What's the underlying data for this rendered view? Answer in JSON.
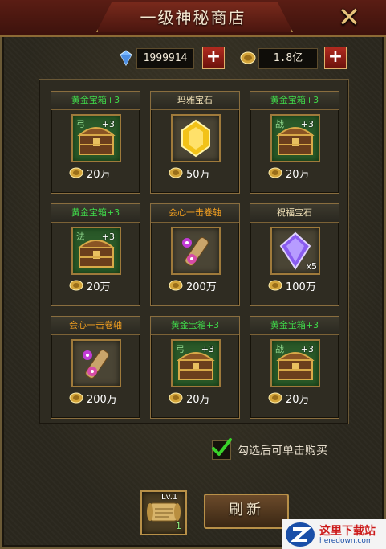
{
  "shop": {
    "title": "一级神秘商店",
    "currencies": [
      {
        "icon": "diamond-icon",
        "value": "1999914"
      },
      {
        "icon": "coin-icon",
        "value": "1.8亿"
      }
    ],
    "add_label": "+",
    "items": [
      {
        "name": "黄金宝箱+3",
        "name_color": "#3fd94a",
        "icon": "gold-chest-icon",
        "slot_tag": "弓",
        "plus": "+3",
        "qty": "",
        "price": "20万"
      },
      {
        "name": "玛雅宝石",
        "name_color": "#f2e2b8",
        "icon": "yellow-gem-icon",
        "slot_tag": "",
        "plus": "",
        "qty": "",
        "price": "50万"
      },
      {
        "name": "黄金宝箱+3",
        "name_color": "#3fd94a",
        "icon": "gold-chest-icon",
        "slot_tag": "战",
        "plus": "+3",
        "qty": "",
        "price": "20万"
      },
      {
        "name": "黄金宝箱+3",
        "name_color": "#3fd94a",
        "icon": "gold-chest-icon",
        "slot_tag": "法",
        "plus": "+3",
        "qty": "",
        "price": "20万"
      },
      {
        "name": "会心一击卷轴",
        "name_color": "#f4a020",
        "icon": "crit-scroll-icon",
        "slot_tag": "",
        "plus": "",
        "qty": "",
        "price": "200万"
      },
      {
        "name": "祝福宝石",
        "name_color": "#f2e2b8",
        "icon": "purple-gem-icon",
        "slot_tag": "",
        "plus": "",
        "qty": "x5",
        "price": "100万"
      },
      {
        "name": "会心一击卷轴",
        "name_color": "#f4a020",
        "icon": "crit-scroll-icon",
        "slot_tag": "",
        "plus": "",
        "qty": "",
        "price": "200万"
      },
      {
        "name": "黄金宝箱+3",
        "name_color": "#3fd94a",
        "icon": "gold-chest-icon",
        "slot_tag": "弓",
        "plus": "+3",
        "qty": "",
        "price": "20万"
      },
      {
        "name": "黄金宝箱+3",
        "name_color": "#3fd94a",
        "icon": "gold-chest-icon",
        "slot_tag": "战",
        "plus": "+3",
        "qty": "",
        "price": "20万"
      }
    ],
    "checkbox_label": "勾选后可单击购买",
    "checkbox_checked": true,
    "refresh_item": {
      "icon": "refresh-scroll-icon",
      "level": "Lv.1",
      "count": "1"
    },
    "refresh_label": "刷新"
  },
  "watermark": {
    "text": "这里下载站",
    "sub": "heredown.com"
  },
  "colors": {
    "accent": "#b89048",
    "title_bg": "#5a1d14",
    "green_name": "#3fd94a",
    "orange_name": "#f4a020"
  }
}
